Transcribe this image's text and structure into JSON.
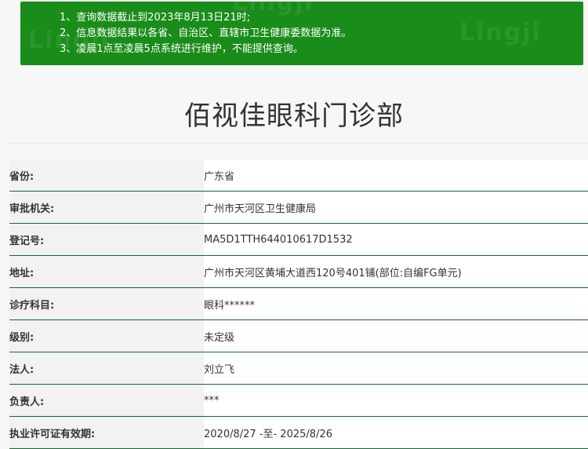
{
  "notice": {
    "lines": [
      "1、查询数据截止到2023年8月13日21时;",
      "2、信息数据结果以各省、自治区、直辖市卫生健康委数据为准。",
      "3、凌晨1点至凌晨5点系统进行维护，不能提供查询。"
    ],
    "watermark": "Lingji"
  },
  "page": {
    "title": "佰视佳眼科门诊部"
  },
  "info_rows": [
    {
      "key": "省份:",
      "value": "广东省"
    },
    {
      "key": "审批机关:",
      "value": "广州市天河区卫生健康局"
    },
    {
      "key": "登记号:",
      "value": "MA5D1TTH644010617D1532"
    },
    {
      "key": "地址:",
      "value": "广州市天河区黄埔大道西120号401铺(部位:自编FG单元)"
    },
    {
      "key": "诊疗科目:",
      "value": "眼科******"
    },
    {
      "key": "级别:",
      "value": "未定级"
    },
    {
      "key": "法人:",
      "value": "刘立飞"
    },
    {
      "key": "负责人:",
      "value": "***"
    },
    {
      "key": "执业许可证有效期:",
      "value": "2020/8/27 -至- 2025/8/26"
    }
  ],
  "colors": {
    "notice_bg": "#1a8c1a",
    "row_border": "#0f6b2f"
  }
}
